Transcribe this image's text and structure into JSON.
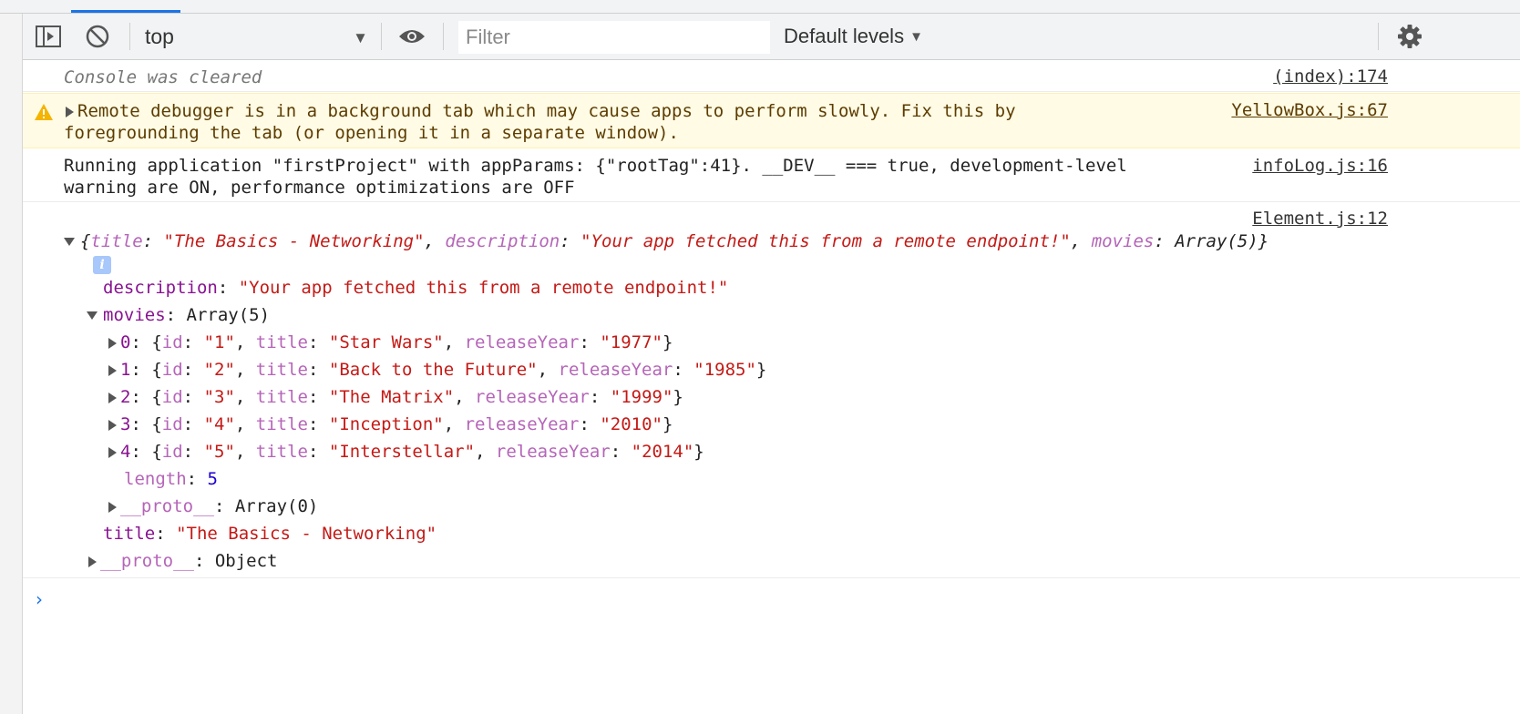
{
  "toolbar": {
    "context": "top",
    "filter_placeholder": "Filter",
    "levels": "Default levels"
  },
  "messages": {
    "cleared": {
      "text": "Console was cleared",
      "source": "(index):174"
    },
    "warning": {
      "line1": "Remote debugger is in a background tab which may cause apps to perform slowly. Fix this by",
      "line2": "foregrounding the tab (or opening it in a separate window).",
      "source": "YellowBox.js:67"
    },
    "info": {
      "line1": "Running application \"firstProject\" with appParams: {\"rootTag\":41}. __DEV__ === true, development-level",
      "line2": "warning are ON, performance optimizations are OFF",
      "source": "infoLog.js:16"
    },
    "object": {
      "source": "Element.js:12",
      "summary_title": "\"The Basics - Networking\"",
      "summary_description": "\"Your app fetched this from a remote endpoint!\"",
      "summary_movies": "Array(5)",
      "description": "\"Your app fetched this from a remote endpoint!\"",
      "movies_type": "Array(5)",
      "movies": [
        {
          "index": "0",
          "id": "\"1\"",
          "title": "\"Star Wars\"",
          "releaseYear": "\"1977\""
        },
        {
          "index": "1",
          "id": "\"2\"",
          "title": "\"Back to the Future\"",
          "releaseYear": "\"1985\""
        },
        {
          "index": "2",
          "id": "\"3\"",
          "title": "\"The Matrix\"",
          "releaseYear": "\"1999\""
        },
        {
          "index": "3",
          "id": "\"4\"",
          "title": "\"Inception\"",
          "releaseYear": "\"2010\""
        },
        {
          "index": "4",
          "id": "\"5\"",
          "title": "\"Interstellar\"",
          "releaseYear": "\"2014\""
        }
      ],
      "length": "5",
      "array_proto": "Array(0)",
      "title": "\"The Basics - Networking\"",
      "object_proto": "Object"
    }
  }
}
